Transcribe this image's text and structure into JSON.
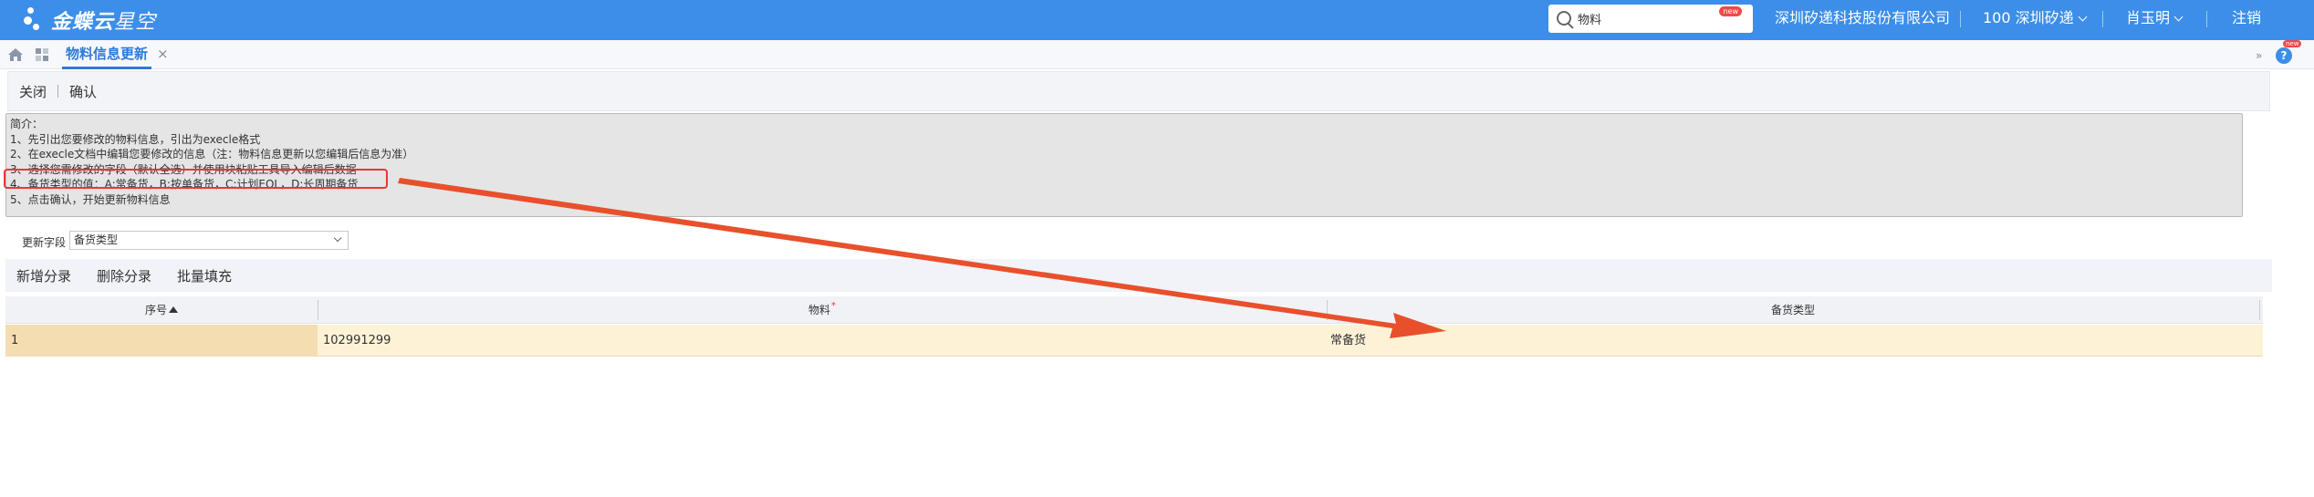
{
  "brand": {
    "name": "金蝶云",
    "product": "星空"
  },
  "header": {
    "search_value": "物料",
    "search_badge": "new",
    "company": "深圳矽递科技股份有限公司",
    "org": "100 深圳矽递",
    "user": "肖玉明",
    "logout": "注销"
  },
  "tabs": {
    "active_label": "物料信息更新",
    "close_symbol": "×",
    "collapse_symbol": "»",
    "help_badge": "new"
  },
  "toolbar": {
    "close_label": "关闭",
    "confirm_label": "确认"
  },
  "intro": {
    "lines": [
      "简介：",
      "1、先引出您要修改的物料信息，引出为execle格式",
      "2、在execle文档中编辑您要修改的信息（注：物料信息更新以您编辑后信息为准）",
      "3、选择您需修改的字段（默认全选）并使用块粘贴工具导入编辑后数据",
      "4、备货类型的值：A:常备货，B:按单备货，C:计划EOL，D:长周期备货",
      "5、点击确认，开始更新物料信息"
    ]
  },
  "field": {
    "label": "更新字段",
    "value": "备货类型"
  },
  "entry_toolbar": {
    "add": "新增分录",
    "delete": "删除分录",
    "batch": "批量填充"
  },
  "grid": {
    "columns": {
      "seq": "序号",
      "material": "物料",
      "required_mark": "*",
      "stock_type": "备货类型"
    },
    "rows": [
      {
        "seq": "1",
        "material": "102991299",
        "stock_type": "常备货"
      }
    ]
  },
  "colors": {
    "header_bg": "#3d8ee8",
    "accent": "#2f7ad9",
    "annotation": "#e8502c",
    "row_highlight": "#fdf2d6"
  }
}
